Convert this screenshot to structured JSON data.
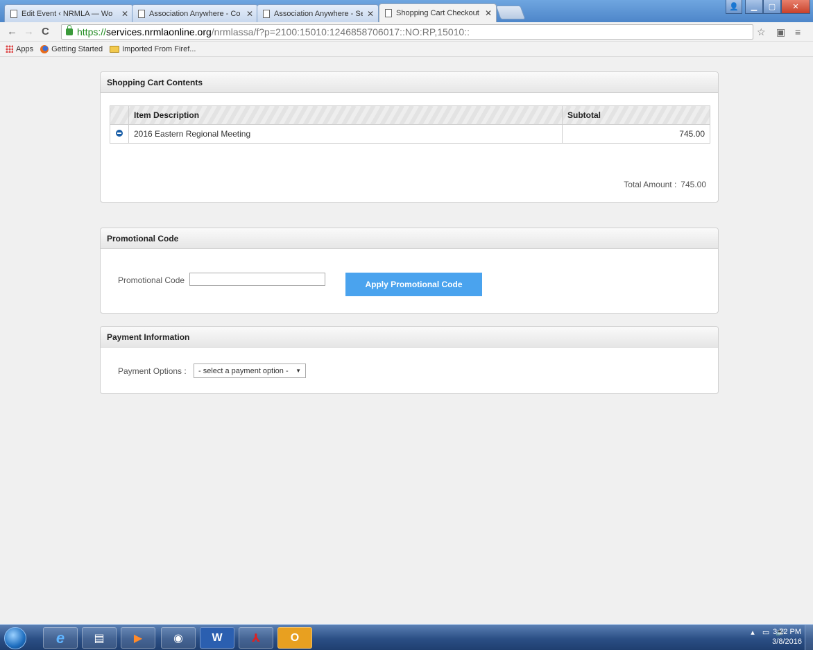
{
  "browser": {
    "tabs": [
      {
        "title": "Edit Event ‹ NRMLA — Wo",
        "active": false
      },
      {
        "title": "Association Anywhere - Co",
        "active": false
      },
      {
        "title": "Association Anywhere - Se",
        "active": false
      },
      {
        "title": "Shopping Cart Checkout",
        "active": true
      }
    ],
    "url": {
      "scheme": "https://",
      "host": "services.nrmlaonline.org",
      "path": "/nrmlassa/f?p=2100:15010:1246858706017::NO:RP,15010::"
    },
    "bookmarks": [
      {
        "label": "Apps",
        "icon": "apps-icon"
      },
      {
        "label": "Getting Started",
        "icon": "firefox-icon"
      },
      {
        "label": "Imported From Firef...",
        "icon": "folder-icon"
      }
    ]
  },
  "cart": {
    "title": "Shopping Cart Contents",
    "columns": [
      "",
      "Item Description",
      "Subtotal"
    ],
    "rows": [
      {
        "description": "2016 Eastern Regional Meeting",
        "subtotal": "745.00"
      }
    ],
    "total_label": "Total Amount :",
    "total_value": "745.00"
  },
  "promo": {
    "title": "Promotional Code",
    "field_label": "Promotional Code",
    "field_value": "",
    "button_label": "Apply Promotional Code"
  },
  "payment": {
    "title": "Payment Information",
    "field_label": "Payment Options :",
    "selected_option": "- select a payment option -"
  },
  "taskbar": {
    "time": "3:22 PM",
    "date": "3/8/2016"
  }
}
